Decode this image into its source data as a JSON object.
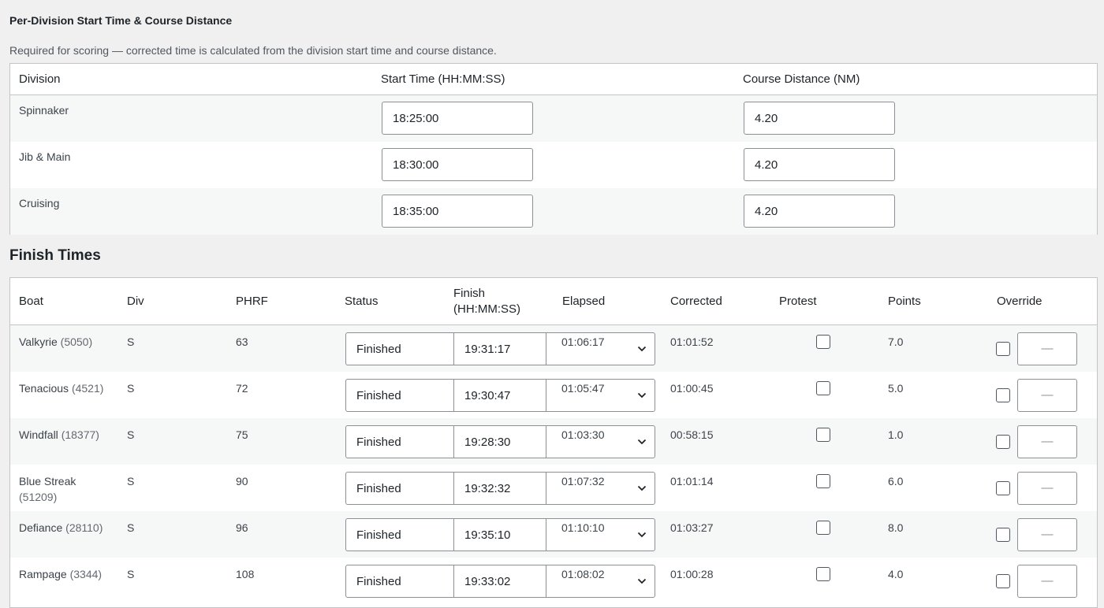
{
  "division_section": {
    "title": "Per-Division Start Time & Course Distance",
    "help": "Required for scoring — corrected time is calculated from the division start time and course distance.",
    "headers": {
      "division": "Division",
      "start_time": "Start Time (HH:MM:SS)",
      "distance": "Course Distance (NM)"
    },
    "rows": [
      {
        "division": "Spinnaker",
        "start_time": "18:25:00",
        "distance": "4.20"
      },
      {
        "division": "Jib & Main",
        "start_time": "18:30:00",
        "distance": "4.20"
      },
      {
        "division": "Cruising",
        "start_time": "18:35:00",
        "distance": "4.20"
      }
    ]
  },
  "finish_section": {
    "title": "Finish Times",
    "headers": {
      "boat": "Boat",
      "div": "Div",
      "phrf": "PHRF",
      "status": "Status",
      "finish_line1": "Finish",
      "finish_line2": "(HH:MM:SS)",
      "elapsed": "Elapsed",
      "corrected": "Corrected",
      "protest": "Protest",
      "points": "Points",
      "override": "Override"
    },
    "rows": [
      {
        "boat": "Valkyrie",
        "sail": "(5050)",
        "div": "S",
        "phrf": "63",
        "status": "Finished",
        "finish": "19:31:17",
        "elapsed": "01:06:17",
        "corrected": "01:01:52",
        "points": "7.0",
        "override": "—"
      },
      {
        "boat": "Tenacious",
        "sail": "(4521)",
        "div": "S",
        "phrf": "72",
        "status": "Finished",
        "finish": "19:30:47",
        "elapsed": "01:05:47",
        "corrected": "01:00:45",
        "points": "5.0",
        "override": "—"
      },
      {
        "boat": "Windfall",
        "sail": "(18377)",
        "div": "S",
        "phrf": "75",
        "status": "Finished",
        "finish": "19:28:30",
        "elapsed": "01:03:30",
        "corrected": "00:58:15",
        "points": "1.0",
        "override": "—"
      },
      {
        "boat": "Blue Streak",
        "sail": "(51209)",
        "div": "S",
        "phrf": "90",
        "status": "Finished",
        "finish": "19:32:32",
        "elapsed": "01:07:32",
        "corrected": "01:01:14",
        "points": "6.0",
        "override": "—"
      },
      {
        "boat": "Defiance",
        "sail": "(28110)",
        "div": "S",
        "phrf": "96",
        "status": "Finished",
        "finish": "19:35:10",
        "elapsed": "01:10:10",
        "corrected": "01:03:27",
        "points": "8.0",
        "override": "—"
      },
      {
        "boat": "Rampage",
        "sail": "(3344)",
        "div": "S",
        "phrf": "108",
        "status": "Finished",
        "finish": "19:33:02",
        "elapsed": "01:08:02",
        "corrected": "01:00:28",
        "points": "4.0",
        "override": "—"
      }
    ]
  },
  "colors": {
    "page_bg": "#f0f0f1",
    "panel_bg": "#ffffff",
    "row_alt": "#f6f7f7",
    "border": "#c3c4c7"
  },
  "icons": {
    "select_arrow": "chevron-down-icon"
  }
}
